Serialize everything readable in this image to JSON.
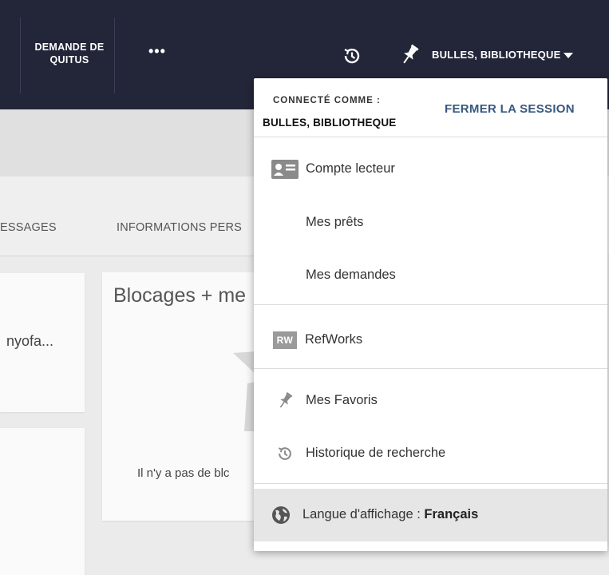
{
  "topbar": {
    "quitus_label": "DEMANDE DE QUITUS",
    "more_label": "•••",
    "user_label": "BULLES, BIBLIOTHEQUE",
    "history_icon": "history-icon",
    "pin_icon": "pin-icon"
  },
  "page": {
    "tabs": [
      "ESSAGES",
      "INFORMATIONS PERS"
    ],
    "card1_text": "nyofa...",
    "card2_title": "Blocages + me",
    "card2_text": "Il n'y a pas de blc"
  },
  "dropdown": {
    "connected_label": "CONNECTÉ COMME :",
    "user_name": "BULLES, BIBLIOTHEQUE",
    "logout_label": "FERMER LA SESSION",
    "items": [
      {
        "label": "Compte lecteur",
        "icon": "id-card-icon"
      },
      {
        "label": "Mes prêts",
        "icon": ""
      },
      {
        "label": "Mes demandes",
        "icon": ""
      },
      {
        "label": "RefWorks",
        "icon": "refworks-icon",
        "badge": "RW"
      },
      {
        "label": "Mes Favoris",
        "icon": "pin-icon"
      },
      {
        "label": "Historique de recherche",
        "icon": "history-icon"
      }
    ],
    "language": {
      "label": "Langue d'affichage :",
      "value": "Français",
      "icon": "globe-icon"
    }
  },
  "colors": {
    "topbar": "#232639",
    "accent": "#37587e",
    "dropdown_highlight": "#e6e6e6"
  }
}
